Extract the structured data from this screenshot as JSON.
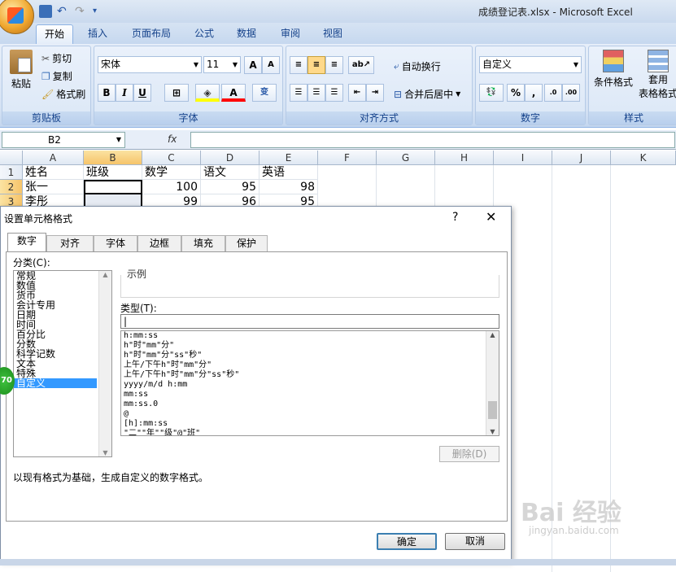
{
  "window": {
    "title": "成绩登记表.xlsx - Microsoft Excel"
  },
  "ribbon_tabs": [
    "开始",
    "插入",
    "页面布局",
    "公式",
    "数据",
    "审阅",
    "视图"
  ],
  "clipboard": {
    "paste": "粘贴",
    "cut": "剪切",
    "copy": "复制",
    "format_painter": "格式刷",
    "group": "剪贴板"
  },
  "font": {
    "name": "宋体",
    "size": "11",
    "bold": "B",
    "italic": "I",
    "underline": "U",
    "group": "字体"
  },
  "alignment": {
    "wrap": "自动换行",
    "merge": "合并后居中",
    "group": "对齐方式"
  },
  "number": {
    "format": "自定义",
    "percent": "%",
    "comma": ",",
    "group": "数字"
  },
  "styles": {
    "conditional": "条件格式",
    "table_line1": "套用",
    "table_line2": "表格格式",
    "group": "样式"
  },
  "formula_bar": {
    "name_box": "B2",
    "fx": "fx",
    "content": ""
  },
  "sheet": {
    "columns": [
      "A",
      "B",
      "C",
      "D",
      "E",
      "F",
      "G",
      "H",
      "I",
      "J",
      "K"
    ],
    "rows": [
      [
        "1",
        "姓名",
        "班级",
        "数学",
        "语文",
        "英语"
      ],
      [
        "2",
        "张一",
        "",
        "100",
        "95",
        "98"
      ],
      [
        "3",
        "李彤",
        "",
        "99",
        "96",
        "95"
      ]
    ]
  },
  "dialog": {
    "title": "设置单元格格式",
    "help": "?",
    "close": "✕",
    "tabs": [
      "数字",
      "对齐",
      "字体",
      "边框",
      "填充",
      "保护"
    ],
    "category_label": "分类(C):",
    "categories": [
      "常规",
      "数值",
      "货币",
      "会计专用",
      "日期",
      "时间",
      "百分比",
      "分数",
      "科学记数",
      "文本",
      "特殊",
      "自定义"
    ],
    "selected_category": "自定义",
    "sample_label": "示例",
    "type_label": "类型(T):",
    "type_value": "|",
    "types": [
      "h:mm:ss",
      "h\"时\"mm\"分\"",
      "h\"时\"mm\"分\"ss\"秒\"",
      "上午/下午h\"时\"mm\"分\"",
      "上午/下午h\"时\"mm\"分\"ss\"秒\"",
      "yyyy/m/d h:mm",
      "mm:ss",
      "mm:ss.0",
      "@",
      "[h]:mm:ss",
      "\"二\"\"年\"\"级\"@\"班\""
    ],
    "delete": "删除(D)",
    "description": "以现有格式为基础，生成自定义的数字格式。",
    "ok": "确定",
    "cancel": "取消"
  },
  "badge": "70",
  "watermark": {
    "main": "Bai 经验",
    "sub": "jingyan.baidu.com"
  }
}
